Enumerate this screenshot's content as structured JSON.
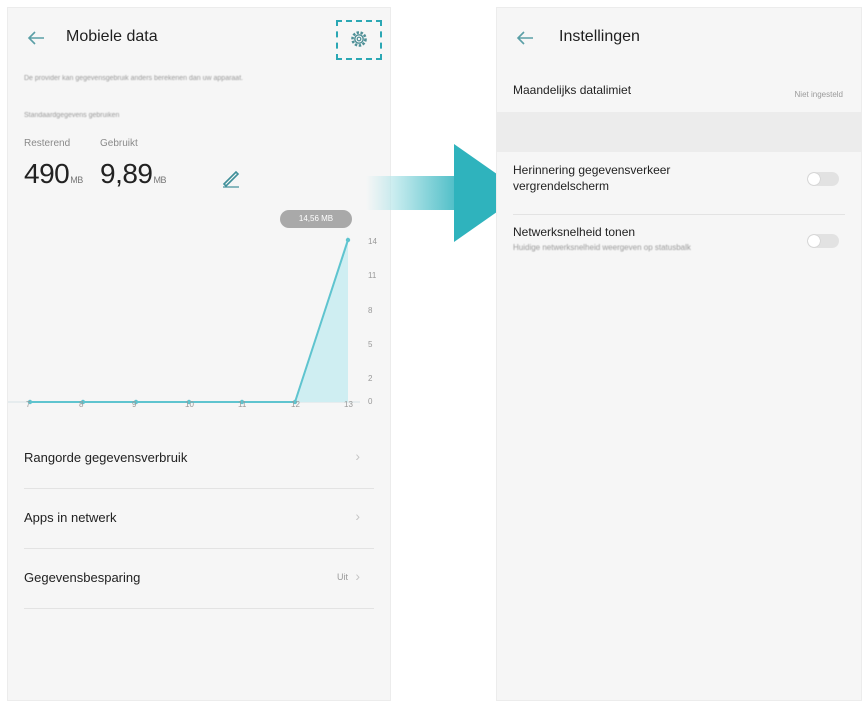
{
  "left_screen": {
    "header": {
      "title": "Mobiele data"
    },
    "note": "De provider kan gegevensgebruik anders berekenen dan uw apparaat.",
    "default_usage": "Standaardgegevens gebruiken",
    "remaining": {
      "label": "Resterend",
      "value": "490",
      "unit": "MB"
    },
    "used": {
      "label": "Gebruikt",
      "value": "9,89",
      "unit": "MB"
    },
    "chart_tooltip": "14,56 MB",
    "chart_y_ticks": [
      "14",
      "11",
      "8",
      "5",
      "2",
      "0"
    ],
    "chart_x_ticks": [
      "7",
      "8",
      "9",
      "10",
      "11",
      "12",
      "13"
    ],
    "menu": [
      {
        "label": "Rangorde gegevensverbruik",
        "value": ""
      },
      {
        "label": "Apps in netwerk",
        "value": ""
      },
      {
        "label": "Gegevensbesparing",
        "value": "Uit"
      }
    ]
  },
  "right_screen": {
    "header": {
      "title": "Instellingen"
    },
    "monthly_limit": {
      "label": "Maandelijks datalimiet",
      "value": "Niet ingesteld"
    },
    "reminder": {
      "label": "Herinnering gegevensverkeer vergrendelscherm",
      "enabled": false
    },
    "network_speed": {
      "label": "Netwerksnelheid tonen",
      "sublabel": "Huidige netwerksnelheid weergeven op statusbalk",
      "enabled": false
    }
  },
  "chart_data": {
    "type": "area",
    "x": [
      "7",
      "8",
      "9",
      "10",
      "11",
      "12",
      "13"
    ],
    "values": [
      0,
      0,
      0,
      0,
      0,
      0,
      14.56
    ],
    "ylim": [
      0,
      14
    ],
    "y_ticks": [
      0,
      2,
      5,
      8,
      11,
      14
    ],
    "annotation": "14,56 MB"
  },
  "colors": {
    "accent": "#2fb3bd",
    "chart_line": "#5fc4cf",
    "chart_fill": "#cfeef2"
  }
}
